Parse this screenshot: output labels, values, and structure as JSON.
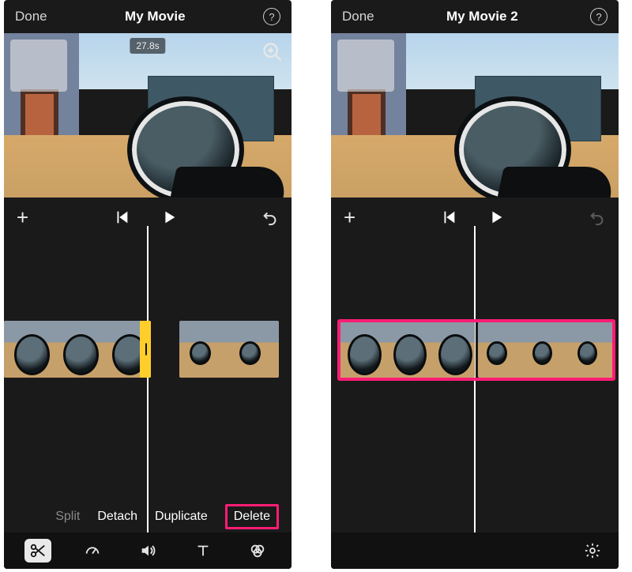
{
  "left": {
    "header": {
      "done": "Done",
      "title": "My Movie",
      "help": "?"
    },
    "preview": {
      "time_chip": "27.8s"
    },
    "timeline": {
      "clip_selected": {
        "handle_glyph": "|"
      }
    },
    "context_actions": {
      "split": "Split",
      "detach": "Detach",
      "duplicate": "Duplicate",
      "delete": "Delete"
    },
    "toolbar": {
      "items": [
        "scissors",
        "speed",
        "volume",
        "text",
        "filters"
      ]
    }
  },
  "right": {
    "header": {
      "done": "Done",
      "title": "My Movie 2",
      "help": "?"
    }
  },
  "icons": {
    "help": "help-circle-icon",
    "zoom": "magnifier-plus-icon",
    "plus": "plus-icon",
    "skip_back": "skip-back-icon",
    "play": "play-icon",
    "undo": "undo-icon",
    "scissors": "scissors-icon",
    "speed": "speedometer-icon",
    "volume": "volume-icon",
    "text": "text-icon",
    "filters": "filters-icon",
    "gear": "gear-icon"
  }
}
